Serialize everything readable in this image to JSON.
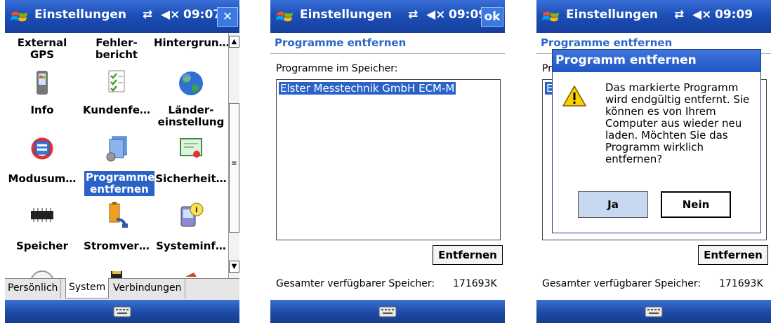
{
  "screen1": {
    "title": "Einstellungen",
    "status": "09:07",
    "close_label": "✕",
    "icons": [
      {
        "label": "External\nGPS",
        "icon": "gps-icon"
      },
      {
        "label": "Fehler-\nbericht",
        "icon": "error-report-icon"
      },
      {
        "label": "Hintergrun…",
        "icon": "background-icon"
      },
      {
        "label": "Info",
        "icon": "info-device-icon"
      },
      {
        "label": "Kundenfe…",
        "icon": "customer-feedback-icon"
      },
      {
        "label": "Länder-\neinstellung",
        "icon": "globe-icon"
      },
      {
        "label": "Modusum…",
        "icon": "mode-switch-icon"
      },
      {
        "label": "Programme\nentfernen",
        "icon": "remove-programs-icon"
      },
      {
        "label": "Sicherheit…",
        "icon": "certificate-icon"
      },
      {
        "label": "Speicher",
        "icon": "memory-chip-icon"
      },
      {
        "label": "Stromver…",
        "icon": "power-icon"
      },
      {
        "label": "Systeminf…",
        "icon": "system-info-icon"
      }
    ],
    "tabs": [
      "Persönlich",
      "System",
      "Verbindungen"
    ],
    "active_tab": "System"
  },
  "screen2": {
    "title": "Einstellungen",
    "status": "09:09",
    "ok_label": "ok",
    "header": "Programme entfernen",
    "list_label": "Programme im Speicher:",
    "list_items": [
      "Elster Messtechnik GmbH ECM-M"
    ],
    "remove_button": "Entfernen",
    "footer_label": "Gesamter verfügbarer Speicher:",
    "footer_value": "171693K"
  },
  "screen3": {
    "title": "Einstellungen",
    "status": "09:09",
    "header": "Programme entfernen",
    "list_label_partial": "Pr",
    "list_item_partial": "E",
    "dialog_title": "Programm entfernen",
    "dialog_message": "Das markierte Programm wird endgültig entfernt. Sie können es von Ihrem Computer aus wieder neu laden. Möchten Sie das Programm wirklich entfernen?",
    "yes_button": "Ja",
    "no_button": "Nein",
    "remove_button": "Entfernen",
    "footer_label": "Gesamter verfügbarer Speicher:",
    "footer_value": "171693K"
  },
  "colors": {
    "titlebar": "#1d4fb8",
    "accent": "#2b67c9",
    "selection": "#2a62c8"
  }
}
